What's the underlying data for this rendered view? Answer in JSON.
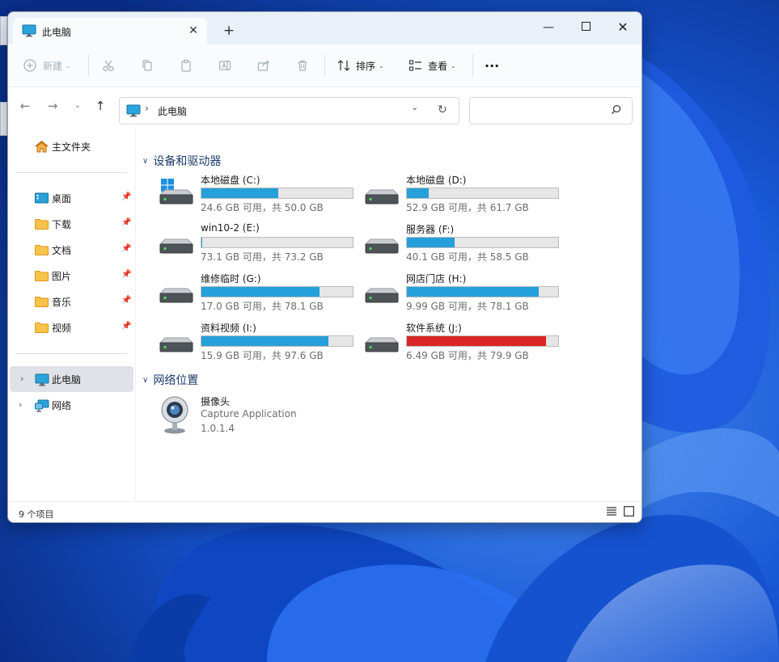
{
  "window": {
    "tab_title": "此电脑",
    "new_tab_symbol": "+",
    "close_tab_symbol": "✕",
    "minimize_symbol": "—",
    "maximize_symbol": "☐",
    "close_symbol": "✕"
  },
  "toolbar": {
    "new_label": "新建",
    "sort_label": "排序",
    "view_label": "查看",
    "more_label": "···"
  },
  "address": {
    "location": "此电脑"
  },
  "sidebar": {
    "home_label": "主文件夹",
    "pinned": [
      {
        "label": "桌面",
        "icon": "desktop-folder-icon"
      },
      {
        "label": "下载",
        "icon": "folder-icon"
      },
      {
        "label": "文档",
        "icon": "folder-icon"
      },
      {
        "label": "图片",
        "icon": "folder-icon"
      },
      {
        "label": "音乐",
        "icon": "folder-icon"
      },
      {
        "label": "视频",
        "icon": "folder-icon"
      }
    ],
    "this_pc_label": "此电脑",
    "network_label": "网络"
  },
  "content": {
    "devices_header": "设备和驱动器",
    "drives": [
      {
        "name": "本地磁盘 (C:)",
        "free": "24.6 GB 可用，共 50.0 GB",
        "used_fraction": 0.508,
        "system": true
      },
      {
        "name": "本地磁盘 (D:)",
        "free": "52.9 GB 可用，共 61.7 GB",
        "used_fraction": 0.143,
        "system": false
      },
      {
        "name": "win10-2 (E:)",
        "free": "73.1 GB 可用，共 73.2 GB",
        "used_fraction": 0.001,
        "system": false
      },
      {
        "name": "服务器 (F:)",
        "free": "40.1 GB 可用，共 58.5 GB",
        "used_fraction": 0.315,
        "system": false
      },
      {
        "name": "维修临时 (G:)",
        "free": "17.0 GB 可用，共 78.1 GB",
        "used_fraction": 0.782,
        "system": false
      },
      {
        "name": "网店门店 (H:)",
        "free": "9.99 GB 可用，共 78.1 GB",
        "used_fraction": 0.872,
        "system": false
      },
      {
        "name": "资料视频 (I:)",
        "free": "15.9 GB 可用，共 97.6 GB",
        "used_fraction": 0.837,
        "system": false
      },
      {
        "name": "软件系统 (J:)",
        "free": "6.49 GB 可用，共 79.9 GB",
        "used_fraction": 0.919,
        "system": false,
        "warning": true
      }
    ],
    "network_header": "网络位置",
    "network_items": [
      {
        "name": "摄像头",
        "subtitle": "Capture Application",
        "version": "1.0.1.4"
      }
    ]
  },
  "status": {
    "item_count": "9 个项目"
  },
  "colors": {
    "bar_normal": "#26a0da",
    "bar_warning": "#da2626",
    "group_header": "#1c3c6e"
  }
}
